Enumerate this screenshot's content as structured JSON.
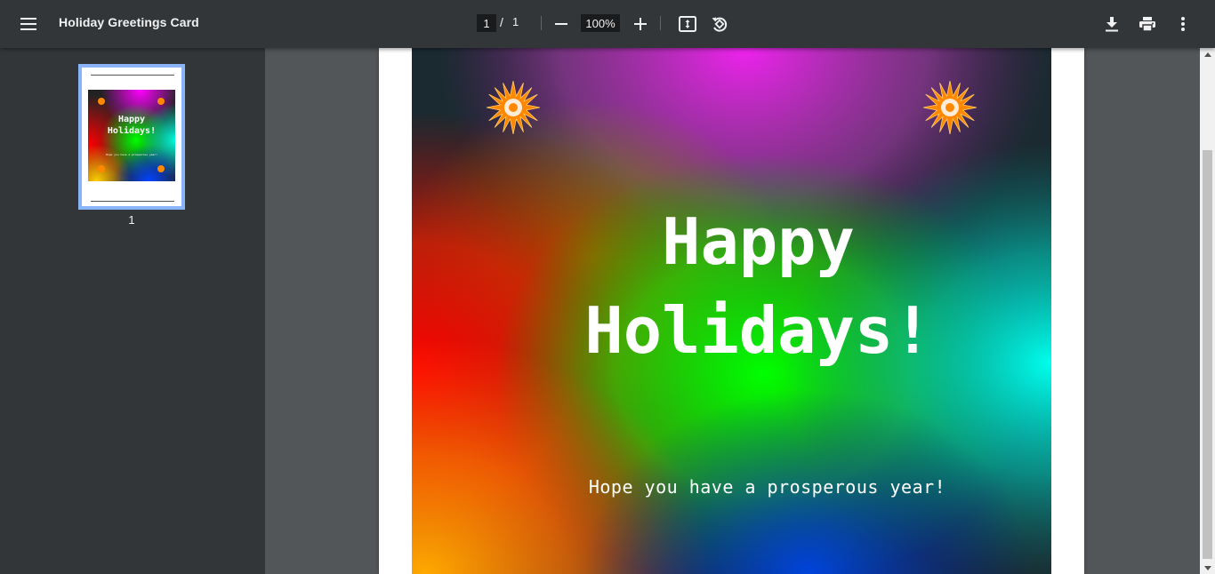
{
  "toolbar": {
    "title": "Holiday Greetings Card",
    "page_current": "1",
    "page_separator": "/",
    "page_total": "1",
    "zoom": "100%",
    "icons": {
      "menu": "menu-icon",
      "zoom_out": "minus-icon",
      "zoom_in": "plus-icon",
      "fit": "fit-to-page-icon",
      "rotate": "rotate-icon",
      "download": "download-icon",
      "print": "print-icon",
      "more": "more-vert-icon"
    }
  },
  "sidebar": {
    "thumbnails": [
      {
        "page_number": "1",
        "selected": true
      }
    ],
    "thumb_title": "Happy\nHolidays!",
    "thumb_subtitle": "Hope you have a prosperous year!"
  },
  "card": {
    "title": "Happy\nHolidays!",
    "subtitle": "Hope you have a prosperous year!",
    "decorations": [
      "sunburst-icon",
      "sunburst-icon"
    ]
  },
  "colors": {
    "toolbar_bg": "#323639",
    "viewer_bg": "#525659",
    "thumb_selected_border": "#8ab4f8",
    "star_fill": "#ff8800"
  }
}
